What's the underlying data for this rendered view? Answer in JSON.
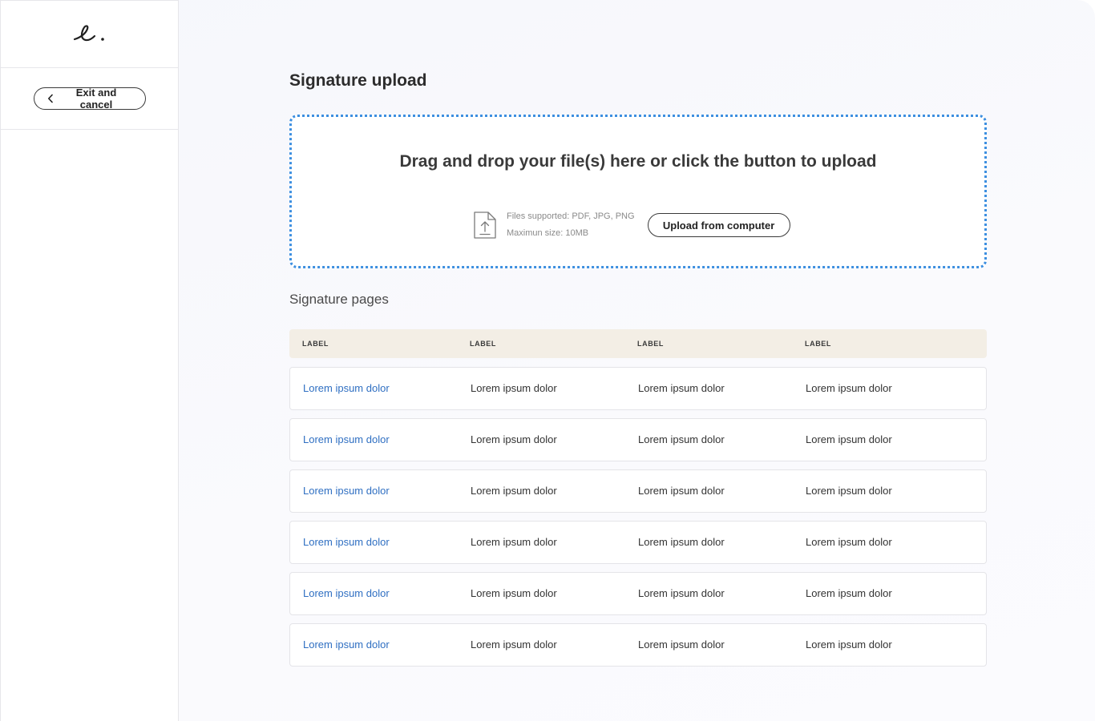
{
  "sidebar": {
    "logo_text": "e.",
    "exit_label": "Exit and cancel"
  },
  "main": {
    "title": "Signature upload",
    "dropzone": {
      "heading": "Drag and drop your file(s) here or click the button to upload",
      "files_supported": "Files supported: PDF, JPG, PNG",
      "max_size": "Maximun size: 10MB",
      "upload_label": "Upload from computer"
    },
    "section_title": "Signature pages",
    "table": {
      "headers": [
        "LABEL",
        "LABEL",
        "LABEL",
        "LABEL"
      ],
      "rows": [
        [
          "Lorem ipsum dolor",
          "Lorem ipsum dolor",
          "Lorem ipsum dolor",
          "Lorem ipsum dolor"
        ],
        [
          "Lorem ipsum dolor",
          "Lorem ipsum dolor",
          "Lorem ipsum dolor",
          "Lorem ipsum dolor"
        ],
        [
          "Lorem ipsum dolor",
          "Lorem ipsum dolor",
          "Lorem ipsum dolor",
          "Lorem ipsum dolor"
        ],
        [
          "Lorem ipsum dolor",
          "Lorem ipsum dolor",
          "Lorem ipsum dolor",
          "Lorem ipsum dolor"
        ],
        [
          "Lorem ipsum dolor",
          "Lorem ipsum dolor",
          "Lorem ipsum dolor",
          "Lorem ipsum dolor"
        ],
        [
          "Lorem ipsum dolor",
          "Lorem ipsum dolor",
          "Lorem ipsum dolor",
          "Lorem ipsum dolor"
        ]
      ]
    }
  },
  "colors": {
    "accent_blue": "#3d8fe0",
    "link_blue": "#2f6fc2",
    "table_header_bg": "#f3eee5"
  },
  "icons": {
    "logo": "script-e-logo",
    "back": "chevron-left-icon",
    "file_upload": "file-upload-icon"
  }
}
